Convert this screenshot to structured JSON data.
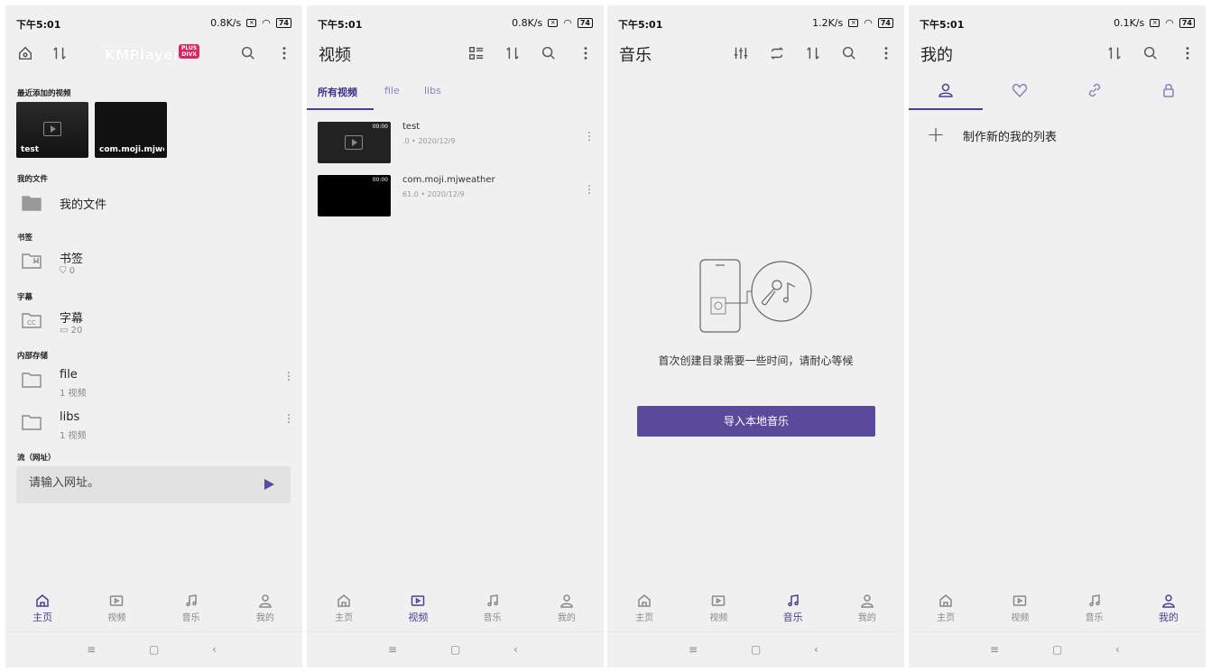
{
  "screens": {
    "home": {
      "status": {
        "time": "下午5:01",
        "speed": "0.8K/s",
        "battery": "74"
      },
      "logo": "KMPlayer",
      "badge_top": "PLUS",
      "badge_bottom": "DIVX",
      "recent_label": "最近添加的视频",
      "recent": [
        {
          "title": "test"
        },
        {
          "title": "com.moji.mjweat"
        }
      ],
      "myfiles_label": "我的文件",
      "myfiles_item": "我的文件",
      "bookmarks_label": "书签",
      "bookmarks_item": "书签",
      "bookmarks_count": "0",
      "subtitles_label": "字幕",
      "subtitles_item": "字幕",
      "subtitles_count": "20",
      "storage_label": "内部存储",
      "folders": [
        {
          "name": "file",
          "count": "1 视频"
        },
        {
          "name": "libs",
          "count": "1 视频"
        }
      ],
      "stream_label": "流（网址）",
      "url_placeholder": "请输入网址。"
    },
    "video": {
      "status": {
        "time": "下午5:01",
        "speed": "0.8K/s",
        "battery": "74"
      },
      "title": "视频",
      "tabs": [
        "所有视频",
        "file",
        "libs"
      ],
      "items": [
        {
          "name": "test",
          "meta": ".0 • 2020/12/9",
          "duration": "00:00"
        },
        {
          "name": "com.moji.mjweather",
          "meta": "61.0 • 2020/12/9",
          "duration": "00:00"
        }
      ]
    },
    "music": {
      "status": {
        "time": "下午5:01",
        "speed": "1.2K/s",
        "battery": "74"
      },
      "title": "音乐",
      "message": "首次创建目录需要一些时间，请耐心等候",
      "import_label": "导入本地音乐"
    },
    "mine": {
      "status": {
        "time": "下午5:01",
        "speed": "0.1K/s",
        "battery": "74"
      },
      "title": "我的",
      "new_list": "制作新的我的列表"
    }
  },
  "nav": {
    "home": "主页",
    "video": "视频",
    "music": "音乐",
    "mine": "我的"
  },
  "colors": {
    "accent": "#4e3d94",
    "button": "#5b4a9b",
    "badge": "#e0245e"
  }
}
